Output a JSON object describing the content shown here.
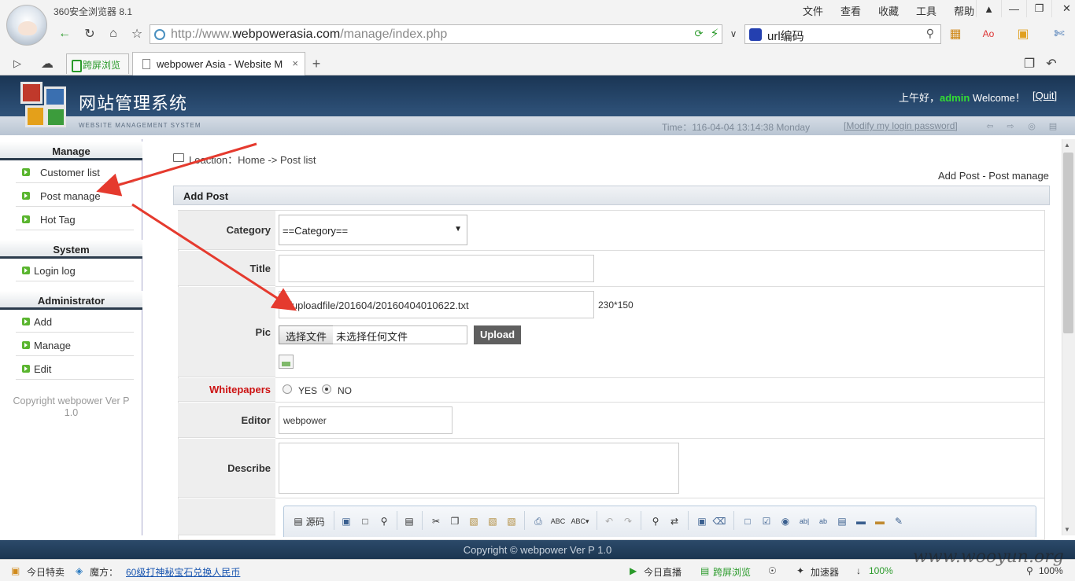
{
  "browser": {
    "app_title": "360安全浏览器 8.1",
    "menus": [
      "文件",
      "查看",
      "收藏",
      "工具",
      "帮助"
    ],
    "url_prefix": "http://www.",
    "url_host": "webpowerasia.com",
    "url_path": "/manage/index.php",
    "search_text": "url编码",
    "tab_split": "跨屏浏览",
    "tab_active": "webpower Asia - Website M",
    "tab_close": "×",
    "new_tab": "+"
  },
  "site": {
    "title": "网站管理系统",
    "subtitle": "WEBSITE MANAGEMENT SYSTEM",
    "greeting_prefix": "上午好，",
    "user": "admin",
    "greeting_suffix": " Welcome！",
    "quit": "[Quit]",
    "time_text": "Time：116-04-04 13:14:38 Monday",
    "modify_password": "[Modify my login password]"
  },
  "sidebar": {
    "sections": [
      {
        "title": "Manage",
        "items": [
          "Customer list",
          "Post manage",
          "Hot Tag"
        ]
      },
      {
        "title": "System",
        "items": [
          "Login log"
        ]
      },
      {
        "title": "Administrator",
        "items": [
          "Add",
          "Manage",
          "Edit"
        ]
      }
    ],
    "copyright_line1": "Copyright webpower Ver P",
    "copyright_line2": "1.0"
  },
  "main": {
    "breadcrumb": "Loaction：Home -> Post list",
    "right_title": "Add Post - Post manage",
    "panel_title": "Add Post",
    "form": {
      "category_label": "Category",
      "category_value": "==Category==",
      "title_label": "Title",
      "title_value": "",
      "pic_label": "Pic",
      "pic_value": "../uploadfile/201604/20160404010622.txt",
      "pic_size_hint": "230*150",
      "file_button": "选择文件",
      "file_status": "未选择任何文件",
      "upload_button": "Upload",
      "whitepapers_label": "Whitepapers",
      "whitepapers_yes": "YES",
      "whitepapers_no": "NO",
      "whitepapers_selected": "NO",
      "editor_label": "Editor",
      "editor_value": "webpower",
      "describe_label": "Describe",
      "toolbar_source": "源码"
    }
  },
  "footer": {
    "copyright": "Copyright © webpower Ver P 1.0"
  },
  "statusbar": {
    "today_deal": "今日特卖",
    "magic_label": "魔方：",
    "magic_link": "60级打神秘宝石兑换人民币",
    "live": "今日直播",
    "split": "跨屏浏览",
    "accelerate": "加速器",
    "download_pct": "100%",
    "zoom": "100%"
  },
  "watermark": "www.wooyun.org",
  "colors": {
    "header_bg": "#2b4d73",
    "whitepapers_label": "#cc1111",
    "admin": "#33dd33",
    "arrow": "#e53a2e"
  }
}
